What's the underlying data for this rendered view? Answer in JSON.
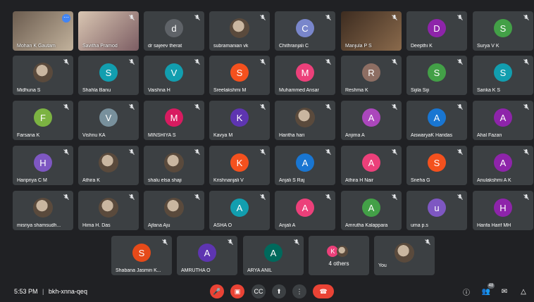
{
  "participants": [
    {
      "name": "Mohan K Gautam",
      "type": "video",
      "variant": "mohan",
      "more": true
    },
    {
      "name": "Savitha Pramod",
      "type": "video",
      "variant": "savitha"
    },
    {
      "name": "dr sajeev therat",
      "initial": "d",
      "color": "#5f6368"
    },
    {
      "name": "subramanian vk",
      "type": "photo"
    },
    {
      "name": "Chithranjali C",
      "initial": "C",
      "color": "#7986cb"
    },
    {
      "name": "Manjula P S",
      "type": "video",
      "variant": "manjula"
    },
    {
      "name": "Deepthi K",
      "initial": "D",
      "color": "#8e24aa"
    },
    {
      "name": "Surya V K",
      "initial": "S",
      "color": "#43a047"
    },
    {
      "name": "Midhuna S",
      "type": "photo"
    },
    {
      "name": "Shahla Banu",
      "initial": "S",
      "color": "#129eaf"
    },
    {
      "name": "Vaishna H",
      "initial": "V",
      "color": "#129eaf"
    },
    {
      "name": "Sreelakshmi M",
      "initial": "S",
      "color": "#f4511e"
    },
    {
      "name": "Muhammed Ansar",
      "initial": "M",
      "color": "#ec407a"
    },
    {
      "name": "Reshma K",
      "initial": "R",
      "color": "#8d6e63"
    },
    {
      "name": "Sijila Siji",
      "initial": "S",
      "color": "#43a047"
    },
    {
      "name": "Sarika K S",
      "initial": "S",
      "color": "#129eaf"
    },
    {
      "name": "Farsana K",
      "initial": "F",
      "color": "#7cb342"
    },
    {
      "name": "Vishnu KA",
      "initial": "V",
      "color": "#78909c"
    },
    {
      "name": "MINSHIYA S",
      "initial": "M",
      "color": "#d81b60"
    },
    {
      "name": "Kavya M",
      "initial": "K",
      "color": "#5e35b1"
    },
    {
      "name": "Haritha hari",
      "type": "photo"
    },
    {
      "name": "Anjima A",
      "initial": "A",
      "color": "#ab47bc"
    },
    {
      "name": "AiswaryaK Haridas",
      "initial": "A",
      "color": "#1976d2"
    },
    {
      "name": "Ahal Fazan",
      "initial": "A",
      "color": "#8e24aa"
    },
    {
      "name": "Haripriya C M",
      "initial": "H",
      "color": "#7e57c2"
    },
    {
      "name": "Athira K",
      "type": "photo"
    },
    {
      "name": "shalu elsa shaji",
      "type": "photo"
    },
    {
      "name": "Krishnanjali V",
      "initial": "K",
      "color": "#f4511e"
    },
    {
      "name": "Anjali S Raj",
      "initial": "A",
      "color": "#1976d2"
    },
    {
      "name": "Athira H Nair",
      "initial": "A",
      "color": "#ec407a"
    },
    {
      "name": "Sneha G",
      "initial": "S",
      "color": "#f4511e"
    },
    {
      "name": "Anulakshmi A K",
      "initial": "A",
      "color": "#8e24aa"
    },
    {
      "name": "misriya shamsudh...",
      "type": "photo"
    },
    {
      "name": "Hima H. Das",
      "type": "photo"
    },
    {
      "name": "Ajfana Aju",
      "type": "photo"
    },
    {
      "name": "ASHA O",
      "initial": "A",
      "color": "#129eaf"
    },
    {
      "name": "Anjali A",
      "initial": "A",
      "color": "#ec407a"
    },
    {
      "name": "Amrutha Kalappara",
      "initial": "A",
      "color": "#43a047"
    },
    {
      "name": "uma p.s",
      "initial": "u",
      "color": "#7e57c2"
    },
    {
      "name": "Hanfa Harif MH",
      "initial": "H",
      "color": "#8e24aa"
    },
    {
      "name": "Shabana Jasmin K...",
      "initial": "S",
      "color": "#e64a19"
    },
    {
      "name": "AMRUTHA O",
      "initial": "A",
      "color": "#5e35b1"
    },
    {
      "name": "ARYA ANIL",
      "initial": "A",
      "color": "#00695c"
    },
    {
      "name": "4 others",
      "type": "others",
      "initial": "K",
      "color": "#ec407a"
    },
    {
      "name": "You",
      "type": "photo"
    }
  ],
  "bottom": {
    "time": "5:53 PM",
    "separator": "|",
    "code": "bkh-xnna-qeq",
    "participant_count": "48"
  }
}
